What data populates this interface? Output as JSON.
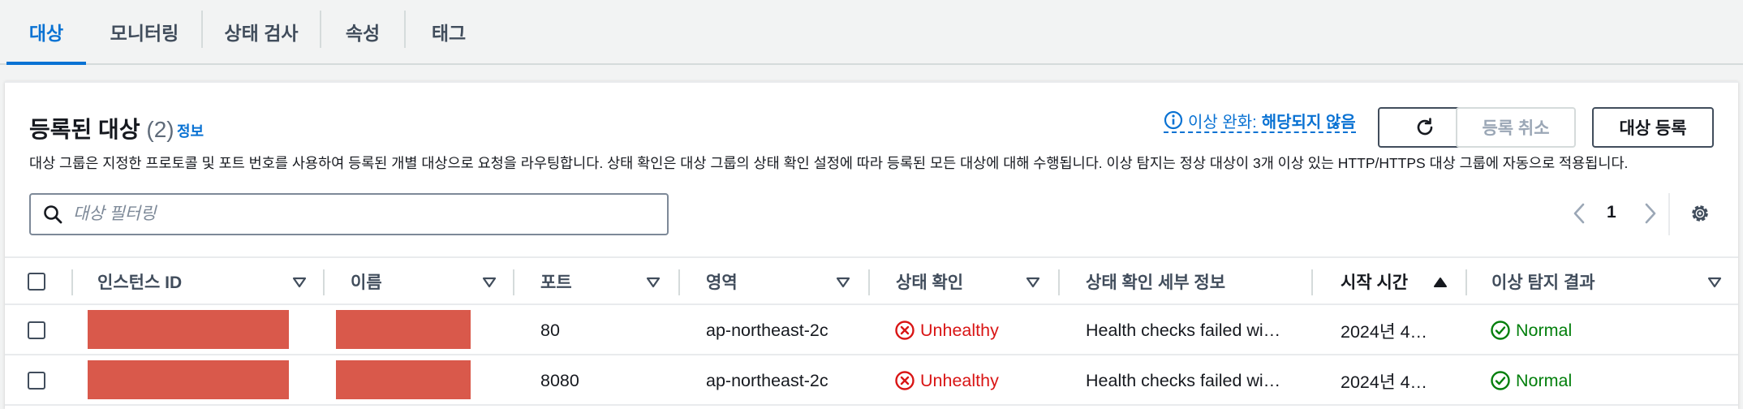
{
  "tabs": [
    {
      "label": "대상",
      "active": true
    },
    {
      "label": "모니터링",
      "active": false
    },
    {
      "label": "상태 검사",
      "active": false
    },
    {
      "label": "속성",
      "active": false
    },
    {
      "label": "태그",
      "active": false
    }
  ],
  "panel": {
    "title": "등록된 대상",
    "count": "(2)",
    "info_link": "정보",
    "description": "대상 그룹은 지정한 프로토콜 및 포트 번호를 사용하여 등록된 개별 대상으로 요청을 라우팅합니다. 상태 확인은 대상 그룹의 상태 확인 설정에 따라 등록된 모든 대상에 대해 수행됩니다. 이상 탐지는 정상 대상이 3개 이상 있는 HTTP/HTTPS 대상 그룹에 자동으로 적용됩니다.",
    "anomaly_label": "이상 완화:",
    "anomaly_value": "해당되지 않음",
    "deregister_label": "등록 취소",
    "register_label": "대상 등록",
    "filter_placeholder": "대상 필터링",
    "page": "1"
  },
  "table": {
    "columns": [
      "인스턴스 ID",
      "이름",
      "포트",
      "영역",
      "상태 확인",
      "상태 확인 세부 정보",
      "시작 시간",
      "이상 탐지 결과"
    ],
    "rows": [
      {
        "instance_id": "",
        "name": "",
        "port": "80",
        "zone": "ap-northeast-2c",
        "health": "Unhealthy",
        "details": "Health checks failed wi…",
        "start": "2024년 4…",
        "anomaly": "Normal"
      },
      {
        "instance_id": "",
        "name": "",
        "port": "8080",
        "zone": "ap-northeast-2c",
        "health": "Unhealthy",
        "details": "Health checks failed wi…",
        "start": "2024년 4…",
        "anomaly": "Normal"
      }
    ]
  },
  "colors": {
    "accent": "#0972d3",
    "unhealthy": "#d91515",
    "normal": "#037f0c",
    "redacted": "#d9594b"
  }
}
